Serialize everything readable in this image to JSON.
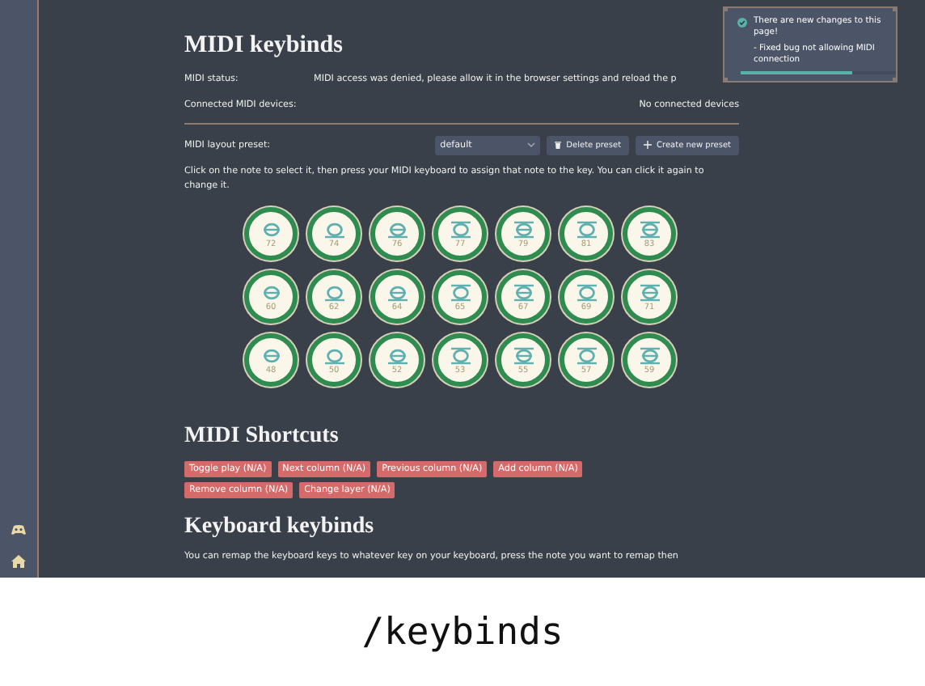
{
  "page": {
    "title": "MIDI keybinds",
    "status": {
      "label": "MIDI status:",
      "value": "MIDI access was denied, please allow it in the browser settings and reload the p"
    },
    "devices": {
      "label": "Connected MIDI devices:",
      "value": "No connected devices"
    },
    "preset": {
      "label": "MIDI layout preset:",
      "value": "default",
      "buttons": [
        {
          "kind": "delete",
          "label": "Delete preset"
        },
        {
          "kind": "create",
          "label": "Create new preset"
        }
      ]
    },
    "instructions": "Click on the note to select it, then press your MIDI keyboard to assign that note to the key. You can click it again to change it.",
    "note_rows": [
      [
        "72",
        "74",
        "76",
        "77",
        "79",
        "81",
        "83"
      ],
      [
        "60",
        "62",
        "64",
        "65",
        "67",
        "69",
        "71"
      ],
      [
        "48",
        "50",
        "52",
        "53",
        "55",
        "57",
        "59"
      ]
    ],
    "shortcuts": {
      "title": "MIDI Shortcuts",
      "items": [
        "Toggle play (N/A)",
        "Next column (N/A)",
        "Previous column (N/A)",
        "Add column (N/A)",
        "Remove column (N/A)",
        "Change layer (N/A)"
      ]
    },
    "keyboard": {
      "title": "Keyboard keybinds",
      "text": "You can remap the keyboard keys to whatever key on your keyboard, press the note you want to remap then"
    }
  },
  "toast": {
    "message": "There are new changes to this page!",
    "detail": "- Fixed bug not allowing MIDI connection",
    "level": 0.72
  },
  "caption": "/keybinds"
}
